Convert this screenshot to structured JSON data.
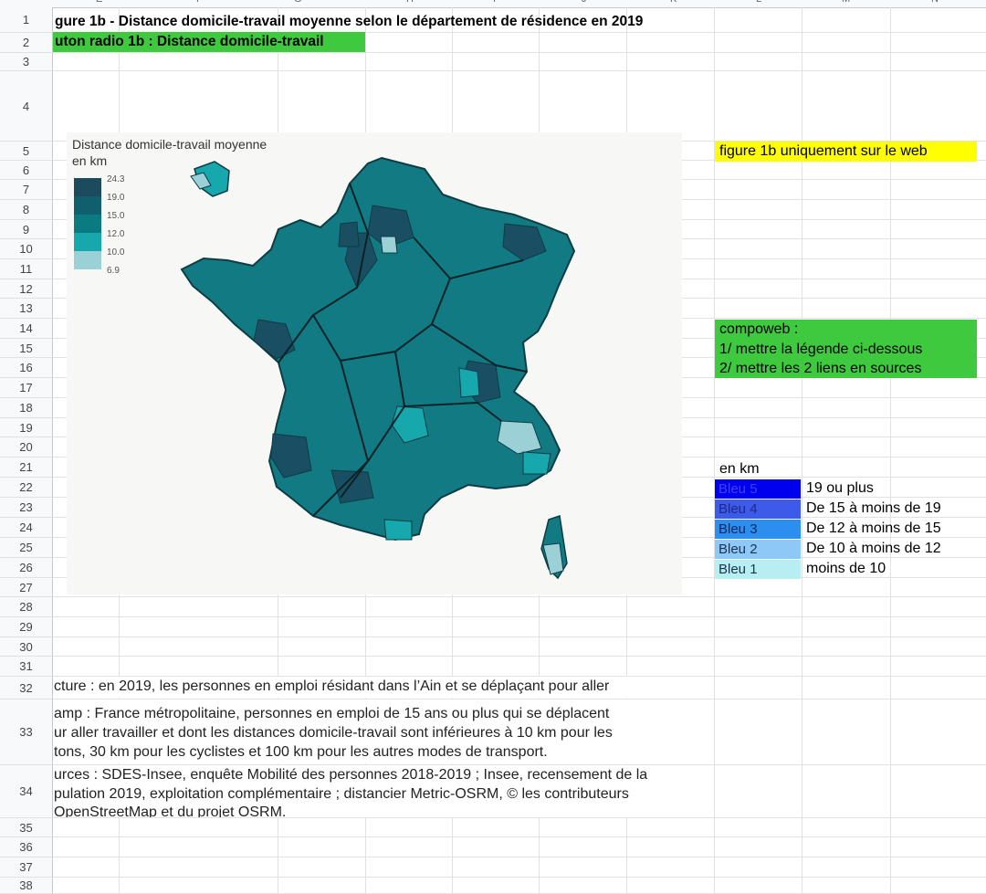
{
  "column_headers": [
    "E",
    "F",
    "G",
    "H",
    "I",
    "J",
    "K",
    "L",
    "M",
    "N"
  ],
  "row_numbers": [
    "1",
    "2",
    "3",
    "4",
    "5",
    "6",
    "7",
    "8",
    "9",
    "10",
    "11",
    "12",
    "13",
    "14",
    "15",
    "16",
    "17",
    "18",
    "19",
    "20",
    "21",
    "22",
    "23",
    "24",
    "25",
    "26",
    "27",
    "28",
    "29",
    "30",
    "31",
    "32",
    "33",
    "34",
    "35",
    "36",
    "37",
    "38"
  ],
  "cells": {
    "title": "gure 1b - Distance domicile-travail moyenne selon le département de résidence en 2019",
    "subtitle": "uton radio 1b : Distance domicile-travail",
    "web_note": "figure 1b uniquement sur le web",
    "compoweb_1": "compoweb :",
    "compoweb_2": "1/ mettre la légende ci-dessous",
    "compoweb_3": "2/ mettre les 2 liens en sources",
    "legend_unit": "en km",
    "lecture": "cture : en 2019, les personnes en emploi résidant dans l’Ain et se déplaçant pour aller",
    "champ_1": "amp : France métropolitaine, personnes en emploi de 15 ans ou plus qui se déplacent",
    "champ_2": "ur aller travailler et dont les distances domicile-travail sont inférieures à 10 km pour les",
    "champ_3": "tons, 30 km pour les cyclistes et 100 km pour les autres modes de transport.",
    "sources_1": "urces : SDES-Insee, enquête Mobilité des personnes 2018-2019 ; Insee, recensement de la",
    "sources_2": "pulation 2019, exploitation complémentaire ; distancier Metric-OSRM, © les contributeurs",
    "sources_3": "OpenStreetMap et du projet OSRM."
  },
  "legend_rows": [
    {
      "name": "Bleu 5",
      "label": "19 ou plus",
      "color": "#0000ee",
      "text_color": "#4040ff"
    },
    {
      "name": "Bleu 4",
      "label": "De 15 à moins de 19",
      "color": "#3d5ae8",
      "text_color": "#1b2a8a"
    },
    {
      "name": "Bleu 3",
      "label": "De 12 à moins de 15",
      "color": "#2c8ff0",
      "text_color": "#0b2a66"
    },
    {
      "name": "Bleu 2",
      "label": "De 10 à moins de 12",
      "color": "#8ec8f7",
      "text_color": "#1a3350"
    },
    {
      "name": "Bleu 1",
      "label": "moins de 10",
      "color": "#b6eef1",
      "text_color": "#1a3350"
    }
  ],
  "map": {
    "legend_title_1": "Distance domicile-travail moyenne",
    "legend_title_2": "en km",
    "legend_ticks": [
      "24.3",
      "19.0",
      "15.0",
      "12.0",
      "10.0",
      "6.9"
    ],
    "legend_colors": [
      "#1d4b5e",
      "#0f5f6e",
      "#0b7b82",
      "#17a8ad",
      "#9bd1d6"
    ]
  }
}
